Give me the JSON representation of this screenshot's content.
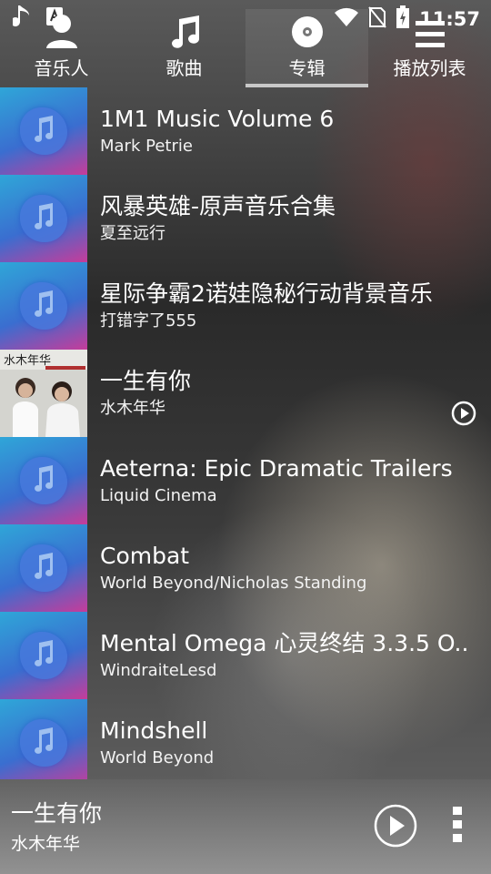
{
  "status_bar": {
    "time": "11:57"
  },
  "tabs": [
    {
      "label": "音乐人",
      "icon": "artist-icon",
      "active": false
    },
    {
      "label": "歌曲",
      "icon": "music-note-icon",
      "active": false
    },
    {
      "label": "专辑",
      "icon": "disc-icon",
      "active": true
    },
    {
      "label": "播放列表",
      "icon": "playlist-icon",
      "active": false
    }
  ],
  "albums": [
    {
      "title": "1M1 Music Volume 6",
      "artist": "Mark Petrie"
    },
    {
      "title": "风暴英雄-原声音乐合集",
      "artist": "夏至远行"
    },
    {
      "title": "星际争霸2诺娃隐秘行动背景音乐",
      "artist": "打错字了555"
    },
    {
      "title": "一生有你",
      "artist": "水木年华",
      "cover_caption": "水木年华"
    },
    {
      "title": "Aeterna: Epic Dramatic Trailers",
      "artist": "Liquid Cinema"
    },
    {
      "title": "Combat",
      "artist": "World Beyond/Nicholas Standing"
    },
    {
      "title": "Mental Omega 心灵终结 3.3.5 O..",
      "artist": "WindraiteLesd"
    },
    {
      "title": "Mindshell",
      "artist": "World Beyond"
    }
  ],
  "now_playing": {
    "title": "一生有你",
    "artist": "水木年华"
  },
  "colors": {
    "accent": "#c8c8c8",
    "default_cover_top": "#2fa6d8",
    "default_cover_bottom": "#c63c9a"
  }
}
